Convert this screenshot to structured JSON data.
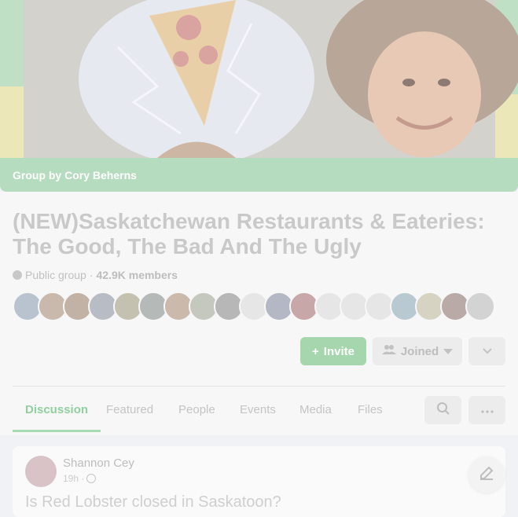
{
  "cover": {
    "group_by_label": "Group by Cory Beherns"
  },
  "group": {
    "title": "(NEW)Saskatchewan Restaurants & Eateries: The Good, The Bad And The Ugly",
    "privacy": "Public group",
    "separator": "·",
    "members": "42.9K members"
  },
  "actions": {
    "invite_label": "Invite",
    "joined_label": "Joined"
  },
  "tabs": [
    {
      "label": "Discussion",
      "active": true
    },
    {
      "label": "Featured",
      "active": false
    },
    {
      "label": "People",
      "active": false
    },
    {
      "label": "Events",
      "active": false
    },
    {
      "label": "Media",
      "active": false
    },
    {
      "label": "Files",
      "active": false
    }
  ],
  "post": {
    "author": "Shannon Cey",
    "time": "19h ·",
    "text": "Is Red Lobster closed in Saskatoon?"
  },
  "colors": {
    "accent": "#a5d6ae",
    "band": "#b6dcbf"
  }
}
